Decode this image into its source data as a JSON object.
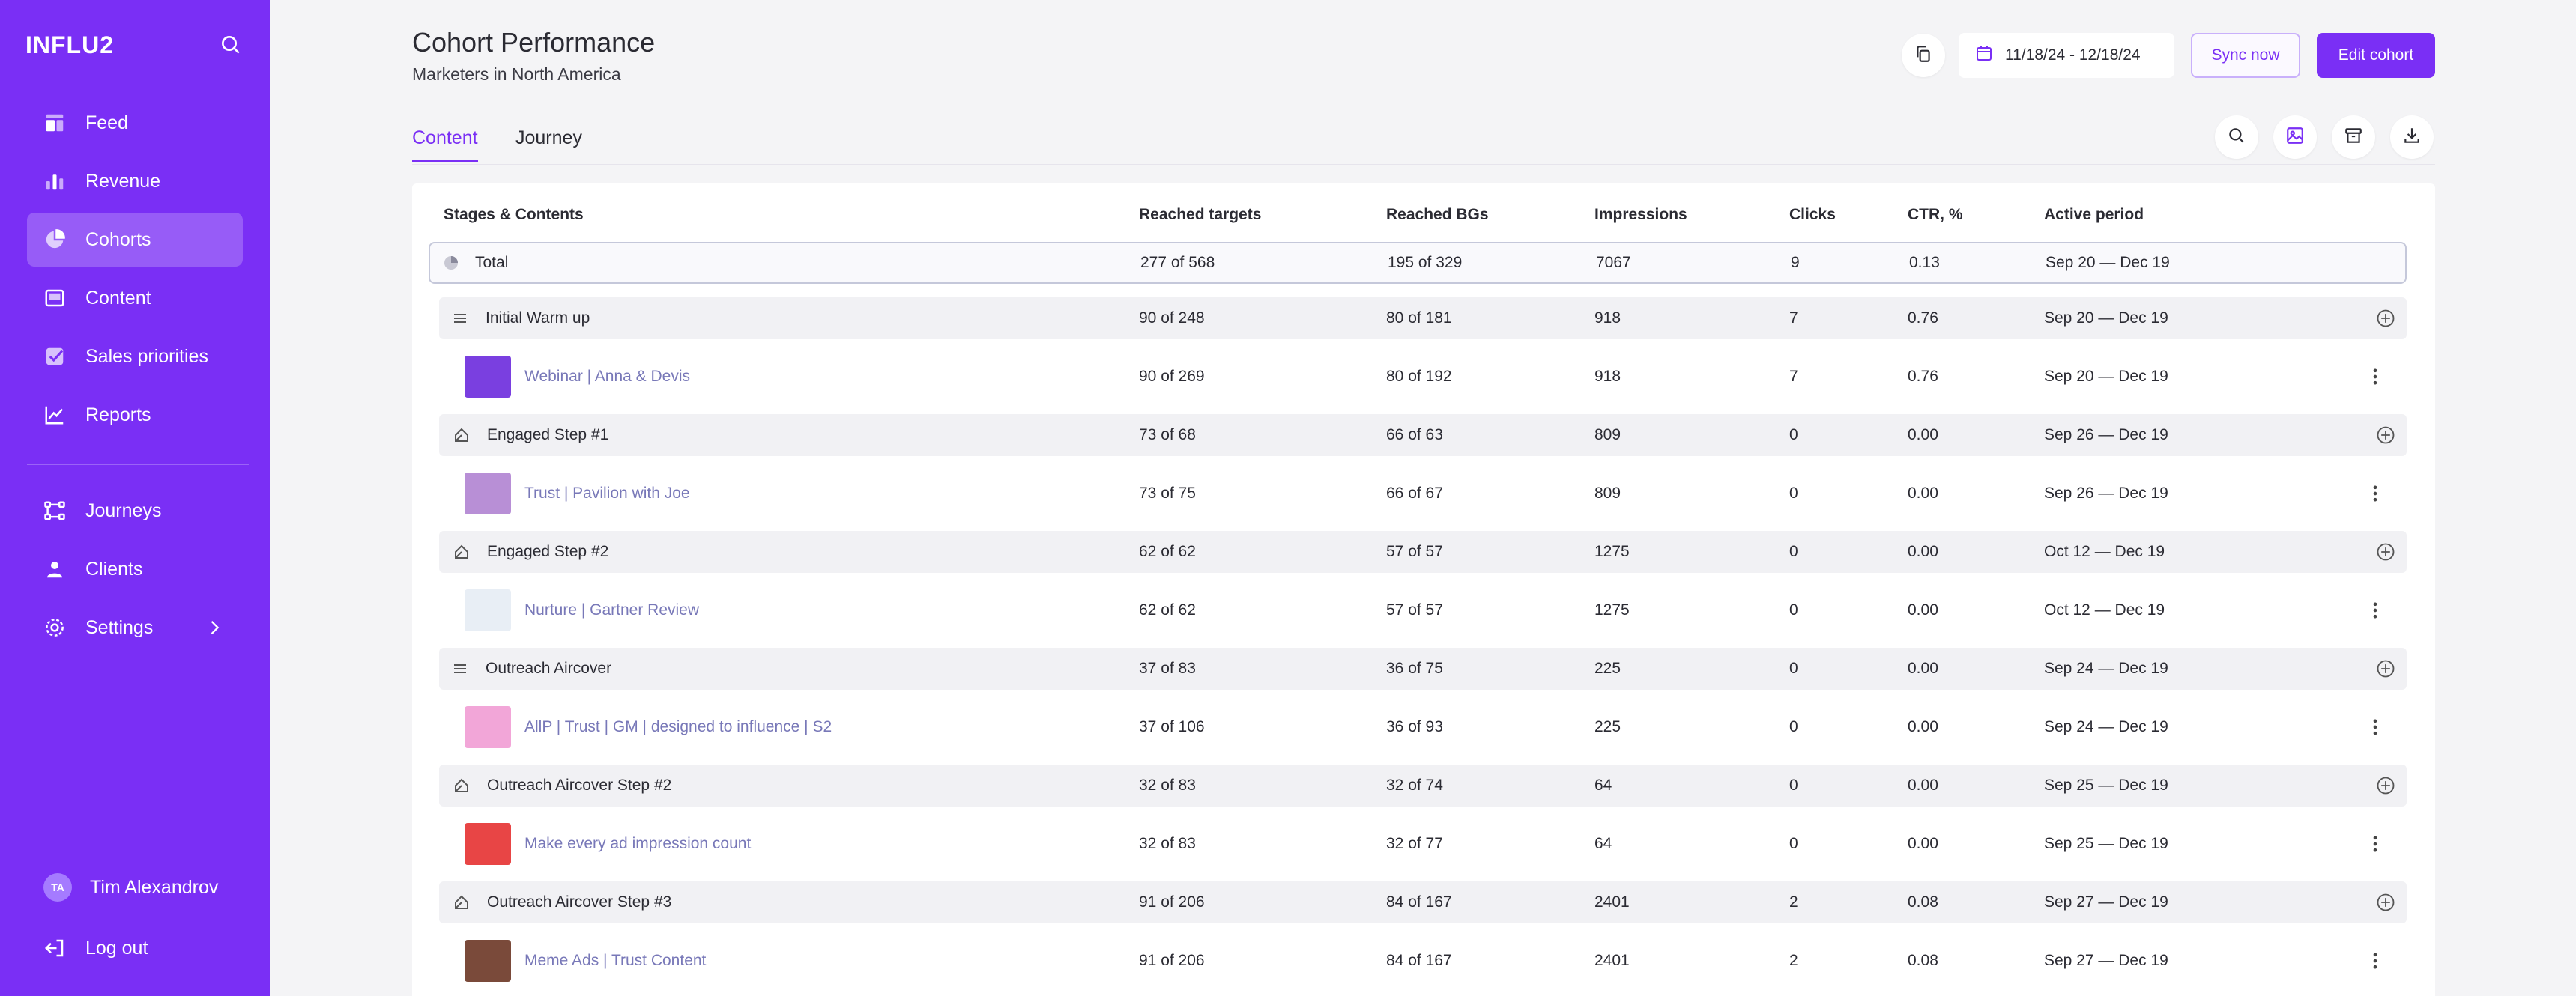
{
  "sidebar": {
    "brand": "INFLU2",
    "items": [
      {
        "label": "Feed",
        "icon": "feed-icon"
      },
      {
        "label": "Revenue",
        "icon": "bar-chart-icon"
      },
      {
        "label": "Cohorts",
        "icon": "pie-chart-icon",
        "active": true
      },
      {
        "label": "Content",
        "icon": "content-icon"
      },
      {
        "label": "Sales priorities",
        "icon": "checkbox-icon"
      },
      {
        "label": "Reports",
        "icon": "line-chart-icon"
      },
      {
        "label": "Journeys",
        "icon": "journeys-icon"
      },
      {
        "label": "Clients",
        "icon": "person-icon"
      },
      {
        "label": "Settings",
        "icon": "gear-icon"
      }
    ],
    "user": {
      "initials": "TA",
      "name": "Tim Alexandrov"
    },
    "logout_label": "Log out"
  },
  "header": {
    "title": "Cohort Performance",
    "subtitle": "Marketers in North America",
    "date_range": "11/18/24 - 12/18/24",
    "sync_label": "Sync now",
    "edit_label": "Edit cohort"
  },
  "tabs": [
    {
      "label": "Content",
      "active": true
    },
    {
      "label": "Journey",
      "active": false
    }
  ],
  "table": {
    "columns": [
      "Stages & Contents",
      "Reached targets",
      "Reached BGs",
      "Impressions",
      "Clicks",
      "CTR, %",
      "Active period"
    ],
    "rows": [
      {
        "type": "total",
        "name": "Total",
        "targets": "277 of 568",
        "bgs": "195 of 329",
        "impressions": "7067",
        "clicks": "9",
        "ctr": "0.13",
        "period": "Sep 20 — Dec 19"
      },
      {
        "type": "stage",
        "icon": "list-icon",
        "name": "Initial Warm up",
        "targets": "90 of 248",
        "bgs": "80 of 181",
        "impressions": "918",
        "clicks": "7",
        "ctr": "0.76",
        "period": "Sep 20 — Dec 19"
      },
      {
        "type": "content",
        "thumb": "#7a3fe0",
        "name": "Webinar | Anna & Devis",
        "targets": "90 of 269",
        "bgs": "80 of 192",
        "impressions": "918",
        "clicks": "7",
        "ctr": "0.76",
        "period": "Sep 20 — Dec 19"
      },
      {
        "type": "step",
        "icon": "step-icon",
        "name": "Engaged Step #1",
        "targets": "73 of 68",
        "bgs": "66 of 63",
        "impressions": "809",
        "clicks": "0",
        "ctr": "0.00",
        "period": "Sep 26 — Dec 19"
      },
      {
        "type": "content",
        "thumb": "#b88fd6",
        "name": "Trust | Pavilion with Joe",
        "targets": "73 of 75",
        "bgs": "66 of 67",
        "impressions": "809",
        "clicks": "0",
        "ctr": "0.00",
        "period": "Sep 26 — Dec 19"
      },
      {
        "type": "step",
        "icon": "step-icon",
        "name": "Engaged Step #2",
        "targets": "62 of 62",
        "bgs": "57 of 57",
        "impressions": "1275",
        "clicks": "0",
        "ctr": "0.00",
        "period": "Oct 12 — Dec 19"
      },
      {
        "type": "content",
        "thumb": "#e8eef5",
        "name": "Nurture | Gartner Review",
        "targets": "62 of 62",
        "bgs": "57 of 57",
        "impressions": "1275",
        "clicks": "0",
        "ctr": "0.00",
        "period": "Oct 12 — Dec 19"
      },
      {
        "type": "stage",
        "icon": "list-icon",
        "name": "Outreach Aircover",
        "targets": "37 of 83",
        "bgs": "36 of 75",
        "impressions": "225",
        "clicks": "0",
        "ctr": "0.00",
        "period": "Sep 24 — Dec 19"
      },
      {
        "type": "content",
        "thumb": "#f2a6d8",
        "name": "AllP | Trust | GM | designed to influence | S2",
        "targets": "37 of 106",
        "bgs": "36 of 93",
        "impressions": "225",
        "clicks": "0",
        "ctr": "0.00",
        "period": "Sep 24 — Dec 19"
      },
      {
        "type": "step",
        "icon": "step-icon",
        "name": "Outreach Aircover Step #2",
        "targets": "32 of 83",
        "bgs": "32 of 74",
        "impressions": "64",
        "clicks": "0",
        "ctr": "0.00",
        "period": "Sep 25 — Dec 19"
      },
      {
        "type": "content",
        "thumb": "#e84545",
        "name": "Make every ad impression count",
        "targets": "32 of 83",
        "bgs": "32 of 77",
        "impressions": "64",
        "clicks": "0",
        "ctr": "0.00",
        "period": "Sep 25 — Dec 19"
      },
      {
        "type": "step",
        "icon": "step-icon",
        "name": "Outreach Aircover Step #3",
        "targets": "91 of 206",
        "bgs": "84 of 167",
        "impressions": "2401",
        "clicks": "2",
        "ctr": "0.08",
        "period": "Sep 27 — Dec 19"
      },
      {
        "type": "content",
        "thumb": "#7a4a3a",
        "name": "Meme Ads | Trust Content",
        "targets": "91 of 206",
        "bgs": "84 of 167",
        "impressions": "2401",
        "clicks": "2",
        "ctr": "0.08",
        "period": "Sep 27 — Dec 19"
      }
    ]
  }
}
